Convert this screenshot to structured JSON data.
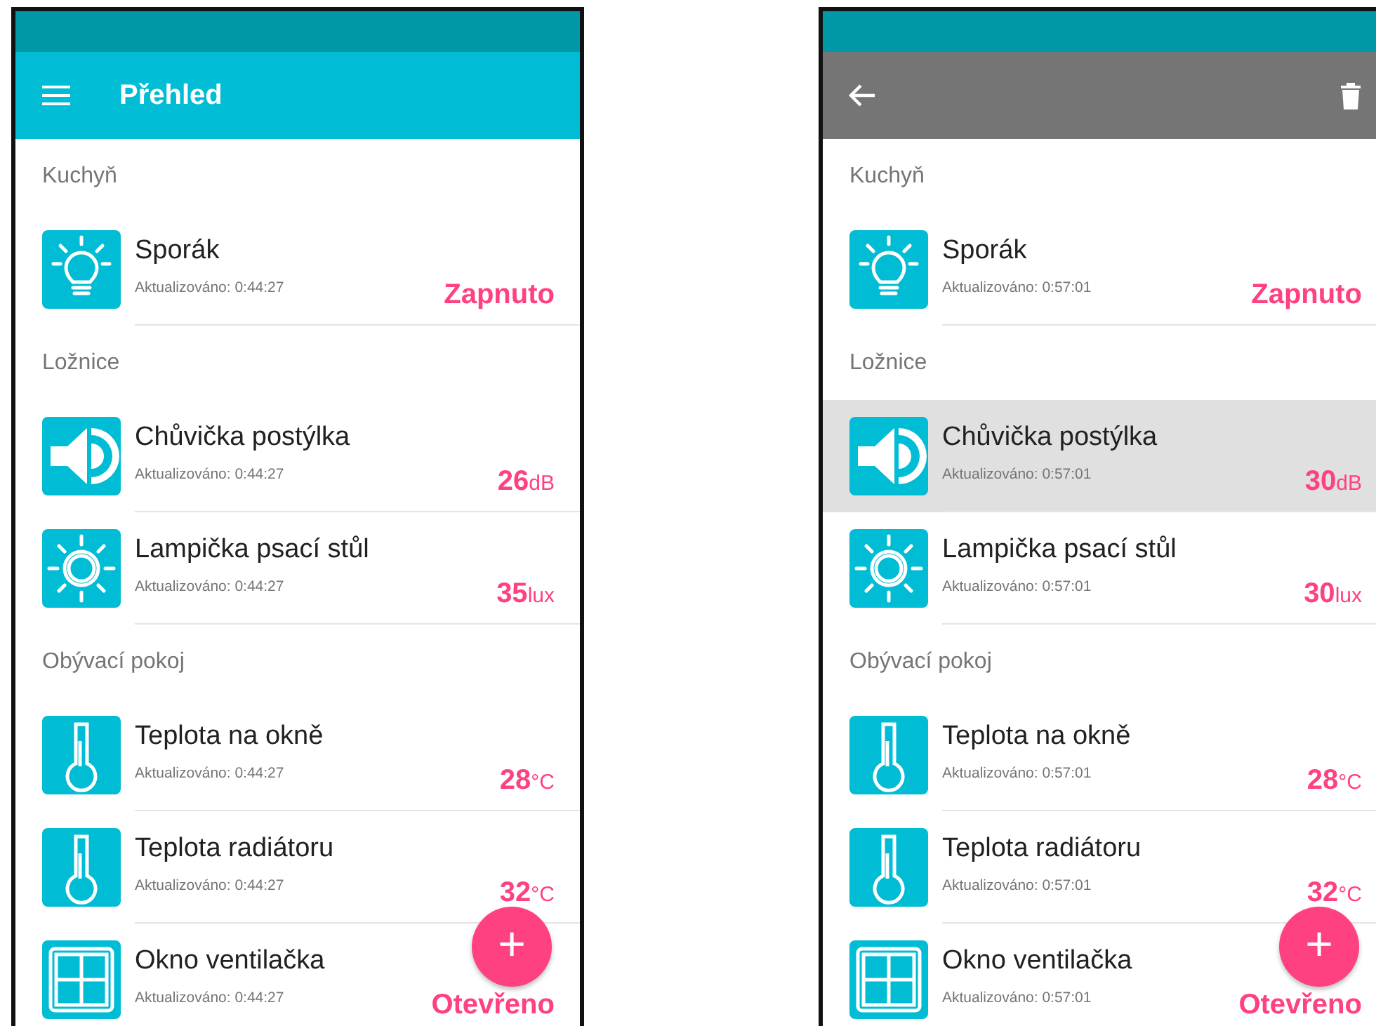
{
  "screens": [
    {
      "toolbar": {
        "kind": "main",
        "title": "Přehled"
      },
      "sections": [
        {
          "title": "Kuchyň",
          "items": [
            {
              "kind": "bulb",
              "name": "Sporák",
              "updated": "Aktualizováno: 0:44:27",
              "value": "Zapnuto",
              "selected": false
            }
          ]
        },
        {
          "title": "Ložnice",
          "items": [
            {
              "kind": "speaker",
              "name": "Chůvička postýlka",
              "updated": "Aktualizováno: 0:44:27",
              "value": "26",
              "unit": "dB",
              "selected": false
            },
            {
              "kind": "sun",
              "name": "Lampička psací stůl",
              "updated": "Aktualizováno: 0:44:27",
              "value": "35",
              "unit": "lux",
              "selected": false
            }
          ]
        },
        {
          "title": "Obývací pokoj",
          "items": [
            {
              "kind": "thermometer",
              "name": "Teplota na okně",
              "updated": "Aktualizováno: 0:44:27",
              "value": "28",
              "unit": "°C",
              "selected": false
            },
            {
              "kind": "thermometer",
              "name": "Teplota radiátoru",
              "updated": "Aktualizováno: 0:44:27",
              "value": "32",
              "unit": "°C",
              "selected": false
            },
            {
              "kind": "window",
              "name": "Okno ventilačka",
              "updated": "Aktualizováno: 0:44:27",
              "value": "Otevřeno",
              "selected": false
            }
          ]
        }
      ],
      "fab": "+"
    },
    {
      "toolbar": {
        "kind": "selection"
      },
      "sections": [
        {
          "title": "Kuchyň",
          "items": [
            {
              "kind": "bulb",
              "name": "Sporák",
              "updated": "Aktualizováno: 0:57:01",
              "value": "Zapnuto",
              "selected": false
            }
          ]
        },
        {
          "title": "Ložnice",
          "items": [
            {
              "kind": "speaker",
              "name": "Chůvička postýlka",
              "updated": "Aktualizováno: 0:57:01",
              "value": "30",
              "unit": "dB",
              "selected": true
            },
            {
              "kind": "sun",
              "name": "Lampička psací stůl",
              "updated": "Aktualizováno: 0:57:01",
              "value": "30",
              "unit": "lux",
              "selected": false
            }
          ]
        },
        {
          "title": "Obývací pokoj",
          "items": [
            {
              "kind": "thermometer",
              "name": "Teplota na okně",
              "updated": "Aktualizováno: 0:57:01",
              "value": "28",
              "unit": "°C",
              "selected": false
            },
            {
              "kind": "thermometer",
              "name": "Teplota radiátoru",
              "updated": "Aktualizováno: 0:57:01",
              "value": "32",
              "unit": "°C",
              "selected": false
            },
            {
              "kind": "window",
              "name": "Okno ventilačka",
              "updated": "Aktualizováno: 0:57:01",
              "value": "Otevřeno",
              "selected": false
            }
          ]
        }
      ],
      "fab": "+"
    }
  ]
}
